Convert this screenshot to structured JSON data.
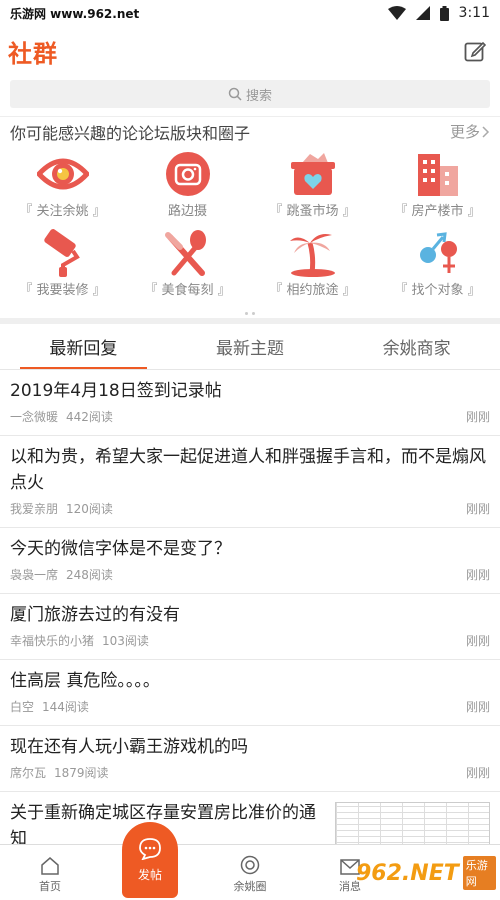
{
  "status_bar": {
    "source": "乐游网 www.962.net",
    "time": "3:11"
  },
  "header": {
    "title": "社群"
  },
  "search": {
    "placeholder": "搜索"
  },
  "interests": {
    "heading": "你可能感兴趣的论论坛版块和圈子",
    "more": "更多",
    "items": [
      {
        "label": "『 关注余姚 』",
        "icon": "eye-icon"
      },
      {
        "label": "路边摄",
        "icon": "camera-icon"
      },
      {
        "label": "『 跳蚤市场 』",
        "icon": "basket-icon"
      },
      {
        "label": "『 房产楼市 』",
        "icon": "building-icon"
      },
      {
        "label": "『 我要装修 』",
        "icon": "paint-roller-icon"
      },
      {
        "label": "『 美食每刻 』",
        "icon": "utensils-icon"
      },
      {
        "label": "『 相约旅途 』",
        "icon": "palm-tree-icon"
      },
      {
        "label": "『 找个对象 』",
        "icon": "gender-icon"
      }
    ]
  },
  "tabs": [
    {
      "label": "最新回复",
      "active": true
    },
    {
      "label": "最新主题",
      "active": false
    },
    {
      "label": "余姚商家",
      "active": false
    }
  ],
  "posts": [
    {
      "title": "2019年4月18日签到记录帖",
      "author": "一念微暖",
      "reads": "442阅读",
      "time": "刚刚"
    },
    {
      "title": "以和为贵，希望大家一起促进道人和胖强握手言和，而不是煽风点火",
      "author": "我爱亲朋",
      "reads": "120阅读",
      "time": "刚刚"
    },
    {
      "title": "今天的微信字体是不是变了？",
      "author": "袅袅一席",
      "reads": "248阅读",
      "time": "刚刚"
    },
    {
      "title": "厦门旅游去过的有没有",
      "author": "幸福快乐的小猪",
      "reads": "103阅读",
      "time": "刚刚"
    },
    {
      "title": "住高层  真危险。。。。",
      "author": "白空",
      "reads": "144阅读",
      "time": "刚刚"
    },
    {
      "title": "现在还有人玩小霸王游戏机的吗",
      "author": "席尔瓦",
      "reads": "1879阅读",
      "time": "刚刚"
    },
    {
      "title": "关于重新确定城区存量安置房比准价的通知",
      "author": "",
      "reads": "",
      "time": ""
    }
  ],
  "bottom_nav": {
    "home": "首页",
    "post": "发帖",
    "circle": "余姚圈",
    "messages": "消息"
  },
  "watermark": {
    "number": "962.NET",
    "sub": "乐游网"
  },
  "colors": {
    "accent": "#ee5a24",
    "icon_red": "#e8584f"
  }
}
